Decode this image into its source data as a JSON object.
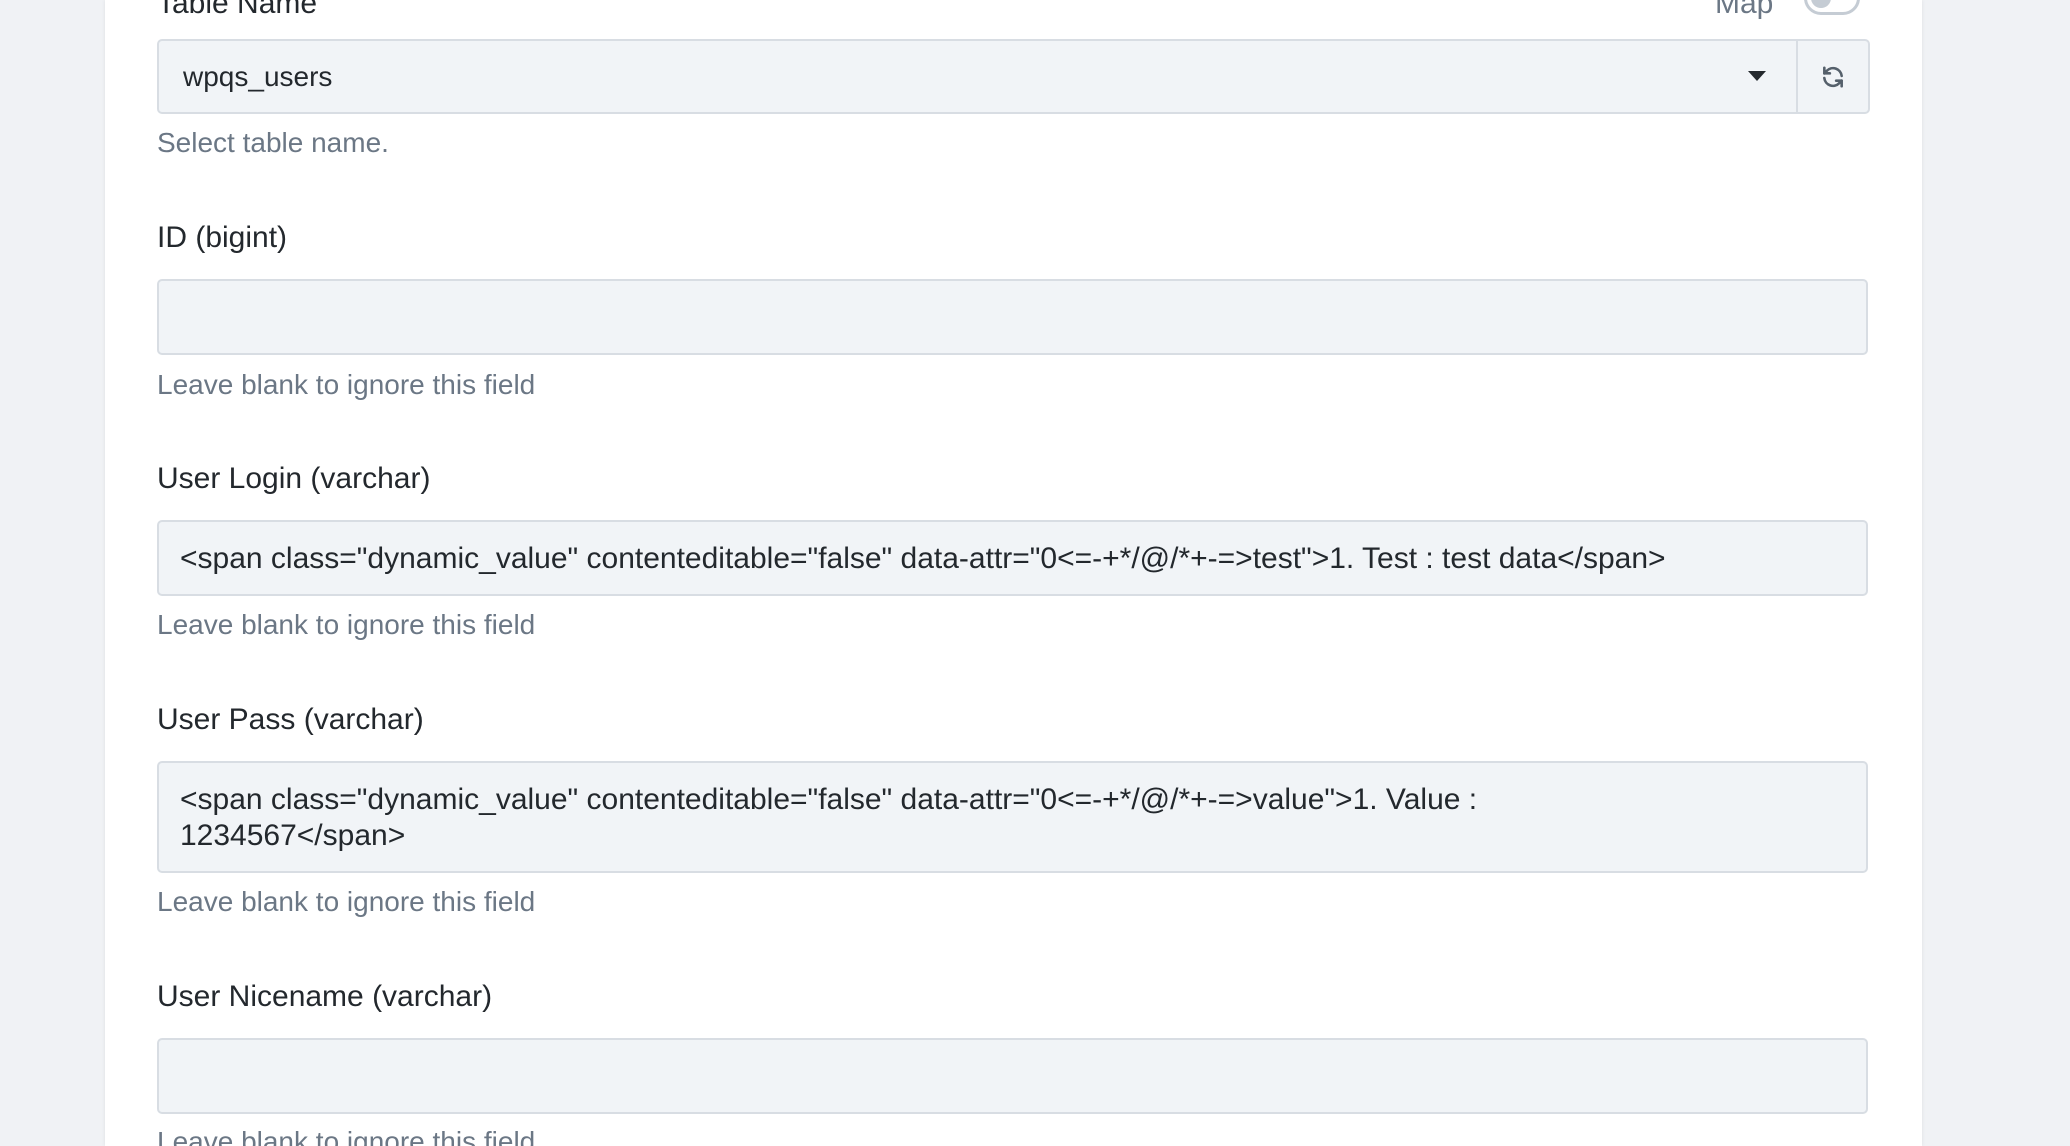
{
  "table_name": {
    "label": "Table Name",
    "map_label": "Map",
    "map_toggle_on": false,
    "selected": "wpqs_users",
    "help": "Select table name."
  },
  "fields": [
    {
      "label": "ID (bigint)",
      "value": "",
      "help": "Leave blank to ignore this field"
    },
    {
      "label": "User Login (varchar)",
      "value": "<span class=\"dynamic_value\" contenteditable=\"false\" data-attr=\"0<=-+*/@/*+-=>test\">1. Test : test data</span>",
      "help": "Leave blank to ignore this field"
    },
    {
      "label": "User Pass (varchar)",
      "value": "<span class=\"dynamic_value\" contenteditable=\"false\" data-attr=\"0<=-+*/@/*+-=>value\">1. Value :\n1234567</span>",
      "help": "Leave blank to ignore this field"
    },
    {
      "label": "User Nicename (varchar)",
      "value": "",
      "help": "Leave blank to ignore this field"
    }
  ],
  "icons": {
    "refresh": "refresh-icon",
    "dropdown": "chevron-down-icon"
  }
}
